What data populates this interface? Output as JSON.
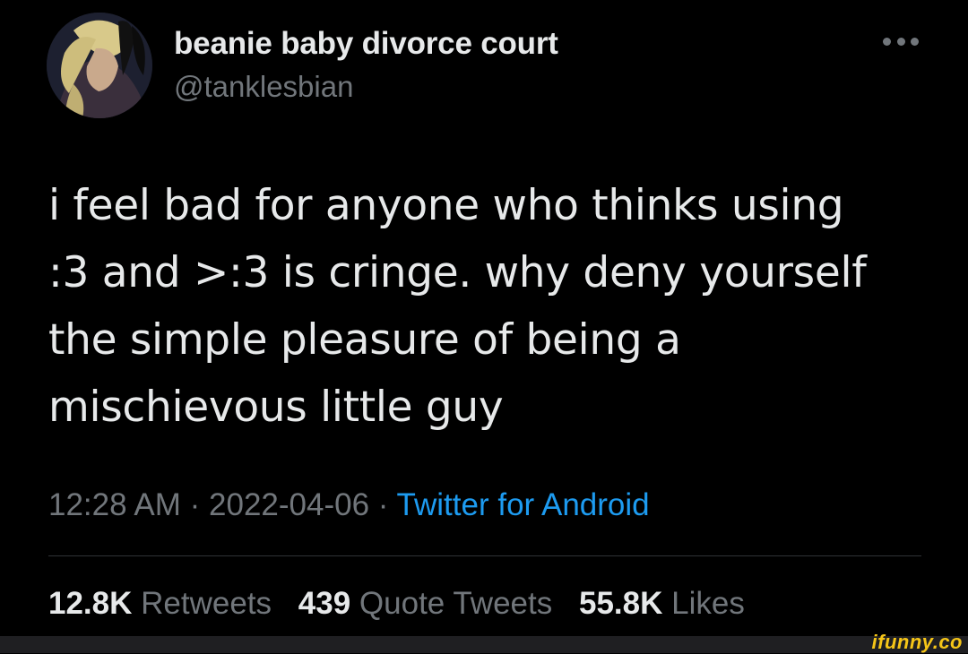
{
  "author": {
    "display_name": "beanie baby divorce court",
    "handle": "@tanklesbian",
    "avatar_icon": "profile-avatar"
  },
  "menu_icon": "more-options-icon",
  "tweet": {
    "lines": [
      "i feel bad for anyone who thinks using",
      ":3 and >:3 is cringe. why deny yourself",
      "the simple pleasure of being a",
      "mischievous little guy"
    ]
  },
  "meta": {
    "time": "12:28 AM",
    "separator": "·",
    "date": "2022-04-06",
    "source": "Twitter for Android"
  },
  "stats": {
    "retweets_count": "12.8K",
    "retweets_label": "Retweets",
    "quotes_count": "439",
    "quotes_label": "Quote Tweets",
    "likes_count": "55.8K",
    "likes_label": "Likes"
  },
  "watermark": "ifunny.co",
  "colors": {
    "background": "#000000",
    "text_primary": "#e7e9ea",
    "text_secondary": "#71767b",
    "link": "#1d9bf0",
    "divider": "#2f3336",
    "watermark": "#f5c518"
  }
}
